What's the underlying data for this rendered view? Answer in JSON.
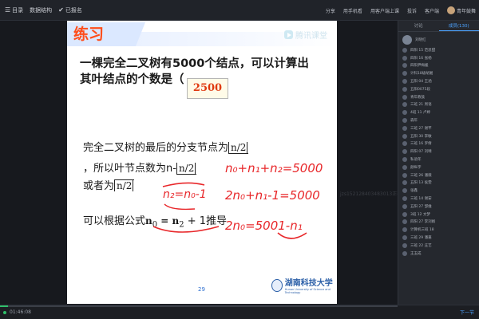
{
  "topbar": {
    "left": [
      {
        "icon": "list-icon",
        "label": "目录"
      },
      {
        "icon": "",
        "label": "数据结构"
      },
      {
        "icon": "check-icon",
        "label": "已报名"
      }
    ],
    "right": [
      {
        "label": "分享"
      },
      {
        "label": "用手机看"
      },
      {
        "label": "用客户端上课"
      },
      {
        "label": "投诉"
      },
      {
        "label": "客户端"
      },
      {
        "label": "青年鼓舞"
      }
    ]
  },
  "slide": {
    "title": "练习",
    "watermark": "腾讯课堂",
    "question_line1": "一棵完全二叉树有5000个结点，可以计算出",
    "question_line2": "其叶结点的个数是（",
    "answer": "2500",
    "line1_prefix": "完全二叉树的最后的分支节点为",
    "line1_math": "n/2",
    "line2_prefix": "，所以叶节点数为n-",
    "line2_math": "n/2",
    "line3_prefix": "或者为",
    "line3_math": "n/2",
    "line4_prefix": "可以根据公式",
    "line4_formula": "n",
    "line4_sub0": "0",
    "line4_eq": " = n",
    "line4_sub2": "2",
    "line4_rest": " + 1推导",
    "page_number": "29",
    "university_name": "湖南科技大学",
    "university_sub": "Hunan University of Science and Technology"
  },
  "handwriting": {
    "eq1": "n₀+n₁+n₂=5000",
    "eq2": "n₂=n₀-1",
    "eq3": "2n₀+n₁-1=5000",
    "eq4": "2n₀=5001-n₁"
  },
  "viewer_overlay": "jzs152128403483013正在观看直播",
  "sidebar": {
    "tabs": [
      "讨论",
      "成员(130)"
    ],
    "active_tab": 1,
    "users": [
      "刘晓红",
      "四阳 15 范思甜",
      "四阳 16 张杨",
      "四阳尹梅媛",
      "计科18级胡湘",
      "五阳 04 王涵",
      "五阳0075段",
      "青年教鼓",
      "三班 21 周语",
      "4班 11 卢婷",
      "森年",
      "三班 27 谢芊",
      "五阳 30 李敏",
      "三班 16 罗倩",
      "四阳 07 刘晴",
      "私语年",
      "颜纵宇",
      "三班 26 潘薇",
      "五阳 13 侯雯",
      "张鑫",
      "三班 14 谢安",
      "五阳 27 邹维",
      "3班 12 文梦",
      "四阳 27 李刘娟",
      "计算机三班 18",
      "三班 29 潘嘉",
      "三班 22 庄艺",
      "王玉成"
    ]
  },
  "bottombar": {
    "time": "01:46:08",
    "next_label": "下一节",
    "progress": 0.02
  },
  "colors": {
    "accent": "#4da3ff",
    "title": "#ff4d1a",
    "answer": "#e03a10",
    "ink": "#e8272a",
    "progress": "#2fbf6a"
  }
}
